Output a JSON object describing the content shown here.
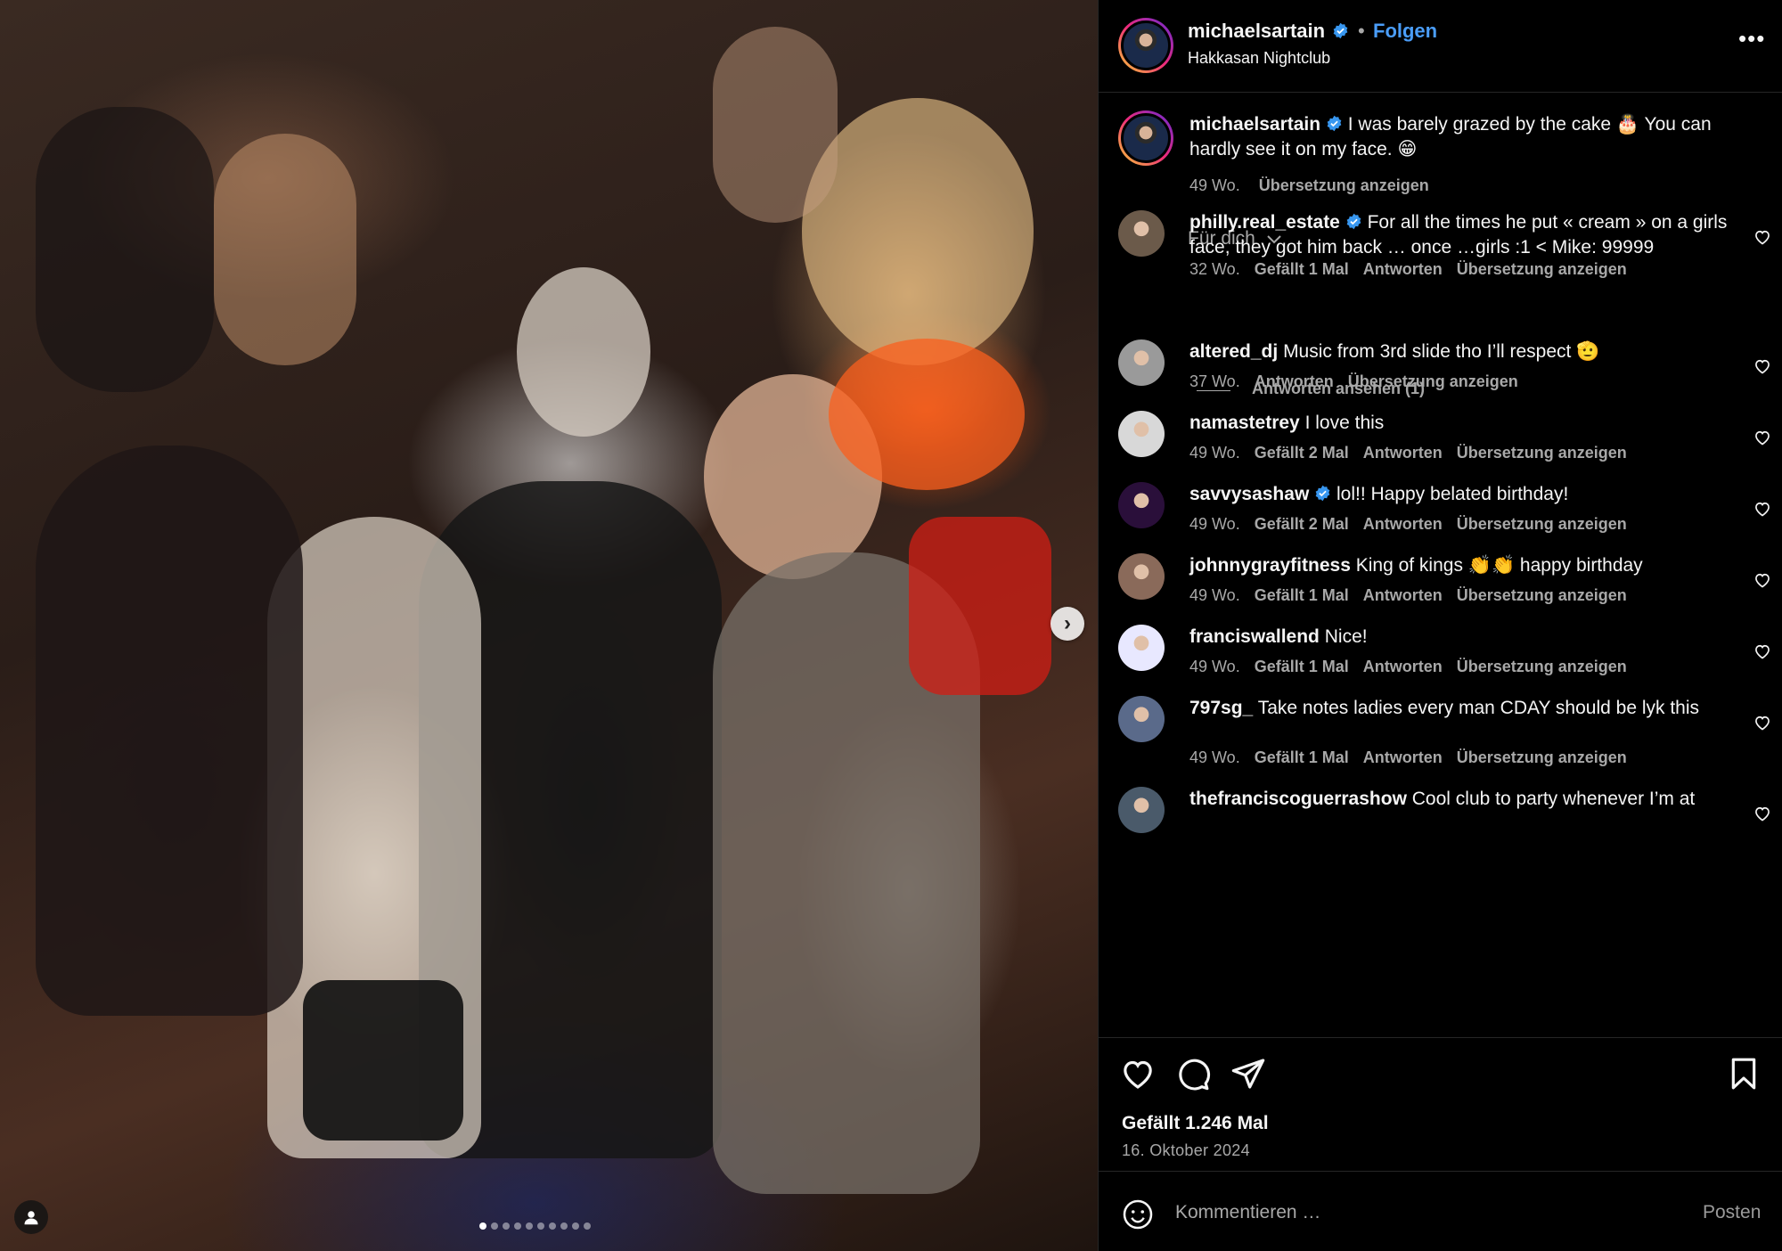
{
  "post": {
    "username": "michaelsartain",
    "separator": "•",
    "follow_label": "Folgen",
    "location": "Hakkasan Nightclub",
    "more_icon": "more-options-icon",
    "caption": {
      "username": "michaelsartain",
      "text": "I was barely grazed by the cake 🎂 You can hardly see it on my face. 😁",
      "time": "49 Wo.",
      "translate": "Übersetzung anzeigen"
    },
    "for_you": "Für dich",
    "view_replies": "Antworten ansehen (1)"
  },
  "comments": [
    {
      "username": "philly.real_estate",
      "verified": true,
      "text": "For all the times he put « cream » on a girls face, they got him back … once …girls :1 < Mike: 99999",
      "time": "32 Wo.",
      "likes": "Gefällt 1 Mal",
      "reply": "Antworten",
      "translate": "Übersetzung anzeigen"
    },
    {
      "username": "altered_dj",
      "verified": false,
      "text": "Music from 3rd slide tho I’ll respect 🫡",
      "time": "37 Wo.",
      "likes": "",
      "reply": "Antworten",
      "translate": "Übersetzung anzeigen"
    },
    {
      "username": "namastetrey",
      "verified": false,
      "text": "I love this",
      "time": "49 Wo.",
      "likes": "Gefällt 2 Mal",
      "reply": "Antworten",
      "translate": "Übersetzung anzeigen"
    },
    {
      "username": "savvysashaw",
      "verified": true,
      "text": "lol!! Happy belated birthday!",
      "time": "49 Wo.",
      "likes": "Gefällt 2 Mal",
      "reply": "Antworten",
      "translate": "Übersetzung anzeigen"
    },
    {
      "username": "johnnygrayfitness",
      "verified": false,
      "text": "King of kings 👏👏 happy birthday",
      "time": "49 Wo.",
      "likes": "Gefällt 1 Mal",
      "reply": "Antworten",
      "translate": "Übersetzung anzeigen"
    },
    {
      "username": "franciswallend",
      "verified": false,
      "text": "Nice!",
      "time": "49 Wo.",
      "likes": "Gefällt 1 Mal",
      "reply": "Antworten",
      "translate": "Übersetzung anzeigen"
    },
    {
      "username": "797sg_",
      "verified": false,
      "text": "Take notes ladies every man CDAY should be lyk this",
      "time": "49 Wo.",
      "likes": "Gefällt 1 Mal",
      "reply": "Antworten",
      "translate": "Übersetzung anzeigen"
    },
    {
      "username": "thefranciscoguerrashow",
      "verified": false,
      "text": "Cool club to party whenever I’m at",
      "time": "",
      "likes": "",
      "reply": "",
      "translate": ""
    }
  ],
  "actions": {
    "like_icon": "heart-icon",
    "comment_icon": "comment-icon",
    "share_icon": "share-icon",
    "save_icon": "bookmark-icon",
    "likes_count": "Gefällt 1.246 Mal",
    "date": "16. Oktober 2024"
  },
  "comment_box": {
    "placeholder": "Kommentieren …",
    "post_label": "Posten"
  },
  "carousel": {
    "slide_count": 10,
    "active_index": 0
  },
  "colors": {
    "background": "#000000",
    "link_blue": "#4a9df8",
    "muted_text": "#a8a8a8",
    "verified_blue": "#3897f0"
  }
}
